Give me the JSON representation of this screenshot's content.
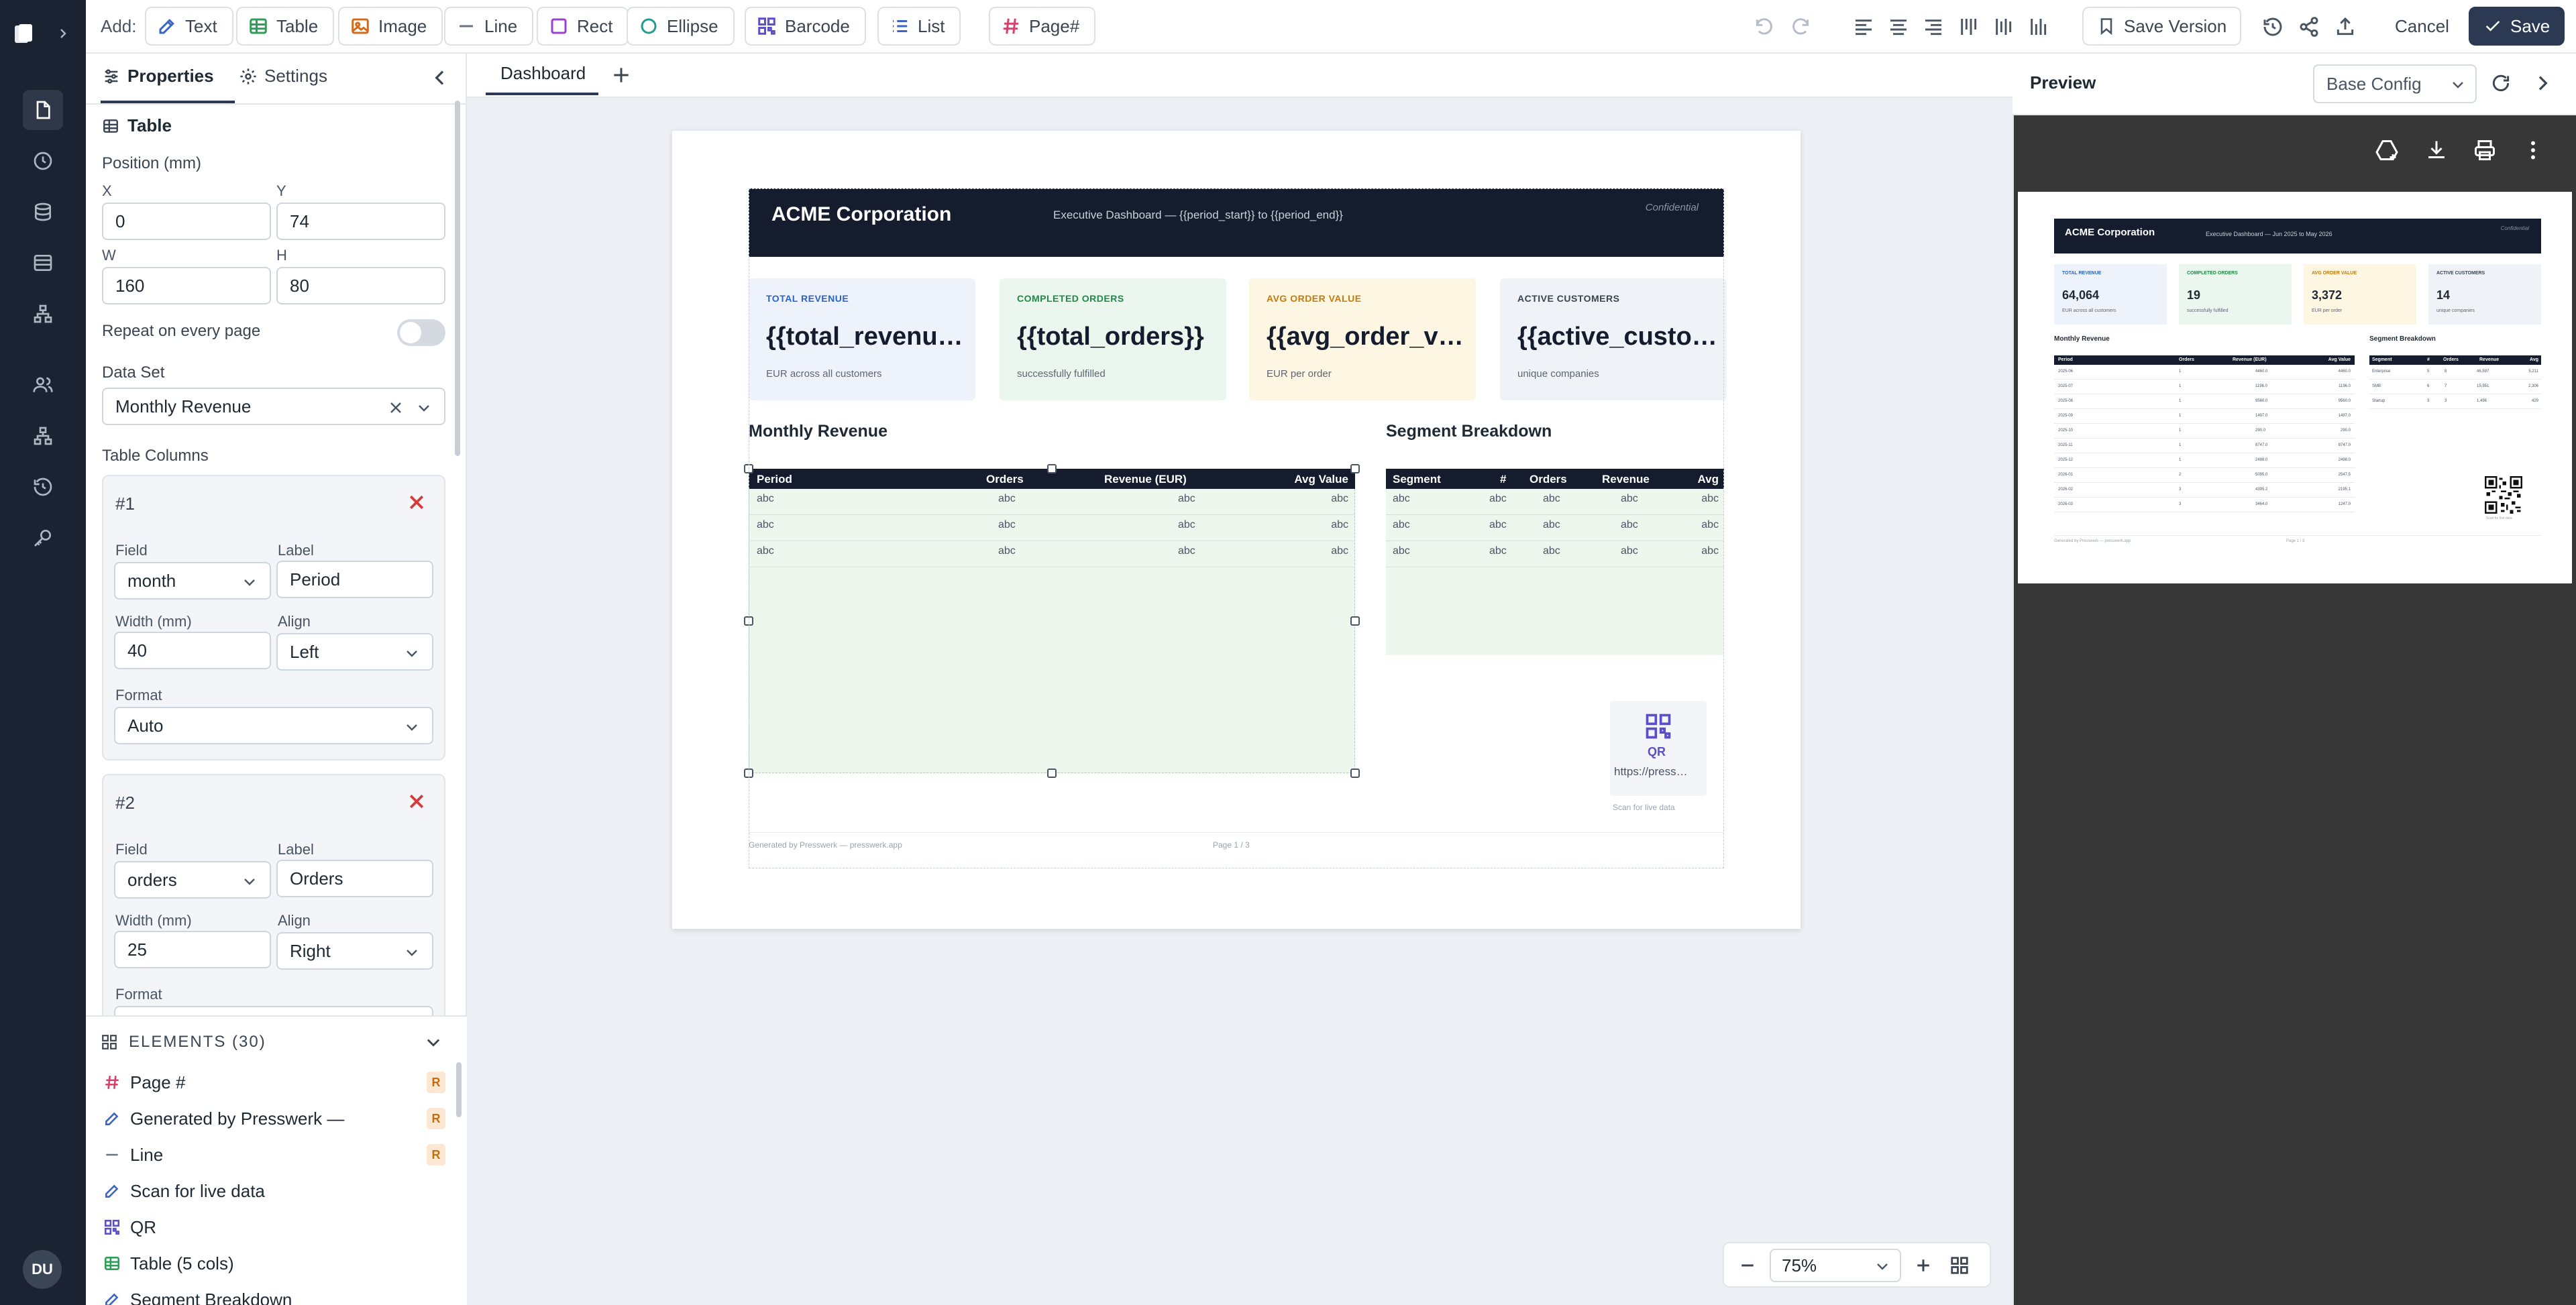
{
  "topbar": {
    "add_label": "Add:",
    "add_buttons": [
      {
        "label": "Text",
        "icon": "text-tool-icon"
      },
      {
        "label": "Table",
        "icon": "table-tool-icon"
      },
      {
        "label": "Image",
        "icon": "image-tool-icon"
      },
      {
        "label": "Line",
        "icon": "line-tool-icon"
      },
      {
        "label": "Rect",
        "icon": "rect-tool-icon"
      },
      {
        "label": "Ellipse",
        "icon": "ellipse-tool-icon"
      },
      {
        "label": "Barcode",
        "icon": "barcode-tool-icon"
      },
      {
        "label": "List",
        "icon": "list-tool-icon"
      },
      {
        "label": "Page#",
        "icon": "page-number-tool-icon"
      }
    ],
    "save_version_label": "Save Version",
    "cancel_label": "Cancel",
    "save_label": "Save"
  },
  "panel": {
    "tab_properties": "Properties",
    "tab_settings": "Settings",
    "element_type": "Table",
    "position_label": "Position (mm)",
    "x_label": "X",
    "x_value": "0",
    "y_label": "Y",
    "y_value": "74",
    "w_label": "W",
    "w_value": "160",
    "h_label": "H",
    "h_value": "80",
    "repeat_label": "Repeat on every page",
    "dataset_label": "Data Set",
    "dataset_value": "Monthly Revenue",
    "columns_label": "Table Columns",
    "columns": [
      {
        "title": "#1",
        "field_label": "Field",
        "field": "month",
        "label_label": "Label",
        "label": "Period",
        "width_label": "Width (mm)",
        "width": "40",
        "align_label": "Align",
        "align": "Left",
        "format_label": "Format",
        "format": "Auto"
      },
      {
        "title": "#2",
        "field_label": "Field",
        "field": "orders",
        "label_label": "Label",
        "label": "Orders",
        "width_label": "Width (mm)",
        "width": "25",
        "align_label": "Align",
        "align": "Right",
        "format_label": "Format"
      }
    ]
  },
  "elements": {
    "header": "ELEMENTS (30)",
    "items": [
      {
        "label": "Page #",
        "badge": "R"
      },
      {
        "label": "Generated by Presswerk —",
        "badge": "R"
      },
      {
        "label": "Line",
        "badge": "R"
      },
      {
        "label": "Scan for live data",
        "badge": ""
      },
      {
        "label": "QR",
        "badge": ""
      },
      {
        "label": "Table (5 cols)",
        "badge": ""
      },
      {
        "label": "Segment Breakdown",
        "badge": ""
      }
    ]
  },
  "canvas": {
    "tab": "Dashboard",
    "zoom": "75%"
  },
  "document": {
    "company": "ACME Corporation",
    "subtitle": "Executive Dashboard — {{period_start}} to {{period_end}}",
    "confidential": "Confidential",
    "kpis": [
      {
        "label": "TOTAL REVENUE",
        "value": "{{total_revenu…",
        "sub": "EUR across all customers",
        "bg": "#eef3fb",
        "fg": "#2c62c7"
      },
      {
        "label": "COMPLETED ORDERS",
        "value": "{{total_orders}}",
        "sub": "successfully fulfilled",
        "bg": "#eaf6ee",
        "fg": "#1f8a45"
      },
      {
        "label": "AVG ORDER VALUE",
        "value": "{{avg_order_v…",
        "sub": "EUR per order",
        "bg": "#fdf6e3",
        "fg": "#c57b0c"
      },
      {
        "label": "ACTIVE CUSTOMERS",
        "value": "{{active_custo…",
        "sub": "unique companies",
        "bg": "#eff2f6",
        "fg": "#3b4451"
      }
    ],
    "monthly_title": "Monthly Revenue",
    "monthly_headers": [
      "Period",
      "Orders",
      "Revenue (EUR)",
      "Avg Value"
    ],
    "monthly_rows": [
      [
        "abc",
        "abc",
        "abc",
        "abc"
      ],
      [
        "abc",
        "abc",
        "abc",
        "abc"
      ],
      [
        "abc",
        "abc",
        "abc",
        "abc"
      ]
    ],
    "segment_title": "Segment Breakdown",
    "segment_headers": [
      "Segment",
      "#",
      "Orders",
      "Revenue",
      "Avg"
    ],
    "segment_rows": [
      [
        "abc",
        "abc",
        "abc",
        "abc",
        "abc"
      ],
      [
        "abc",
        "abc",
        "abc",
        "abc",
        "abc"
      ],
      [
        "abc",
        "abc",
        "abc",
        "abc",
        "abc"
      ]
    ],
    "qr_label": "QR",
    "qr_url": "https://press…",
    "qr_caption": "Scan for live data",
    "footer_left": "Generated by Presswerk — presswerk.app",
    "footer_page": "Page 1 / 3"
  },
  "preview": {
    "title": "Preview",
    "config": "Base Config",
    "company": "ACME Corporation",
    "subtitle": "Executive Dashboard — Jun 2025 to May 2026",
    "confidential": "Confidential",
    "kpis": [
      {
        "label": "TOTAL REVENUE",
        "value": "64,064",
        "sub": "EUR across all customers"
      },
      {
        "label": "COMPLETED ORDERS",
        "value": "19",
        "sub": "successfully fulfilled"
      },
      {
        "label": "AVG ORDER VALUE",
        "value": "3,372",
        "sub": "EUR per order"
      },
      {
        "label": "ACTIVE CUSTOMERS",
        "value": "14",
        "sub": "unique companies"
      }
    ],
    "monthly_title": "Monthly Revenue",
    "monthly_headers": [
      "Period",
      "Orders",
      "Revenue (EUR)",
      "Avg Value"
    ],
    "monthly_rows": [
      [
        "2025-06",
        "1",
        "4460.0",
        "4460.0"
      ],
      [
        "2025-07",
        "1",
        "1196.0",
        "1196.0"
      ],
      [
        "2025-08",
        "1",
        "9560.0",
        "9560.0"
      ],
      [
        "2025-09",
        "1",
        "1497.0",
        "1497.0"
      ],
      [
        "2025-10",
        "1",
        "290.0",
        "290.0"
      ],
      [
        "2025-11",
        "1",
        "8747.0",
        "8747.0"
      ],
      [
        "2025-12",
        "1",
        "2498.0",
        "2498.0"
      ],
      [
        "2026-01",
        "2",
        "5095.0",
        "2547.5"
      ],
      [
        "2026-02",
        "3",
        "4395.2",
        "2195.1"
      ],
      [
        "2026-03",
        "3",
        "3464.0",
        "1247.0"
      ]
    ],
    "segment_title": "Segment Breakdown",
    "segment_headers": [
      "Segment",
      "#",
      "Orders",
      "Revenue",
      "Avg"
    ],
    "segment_rows": [
      [
        "Enterprise",
        "5",
        "8",
        "46,597",
        "5,211"
      ],
      [
        "SMB",
        "6",
        "7",
        "15,951",
        "2,306"
      ],
      [
        "Startup",
        "3",
        "3",
        "1,496",
        "429"
      ]
    ],
    "qr_caption": "Scan for live data",
    "footer_left": "Generated by Presswerk — presswerk.app",
    "footer_page": "Page 1 / 3"
  }
}
